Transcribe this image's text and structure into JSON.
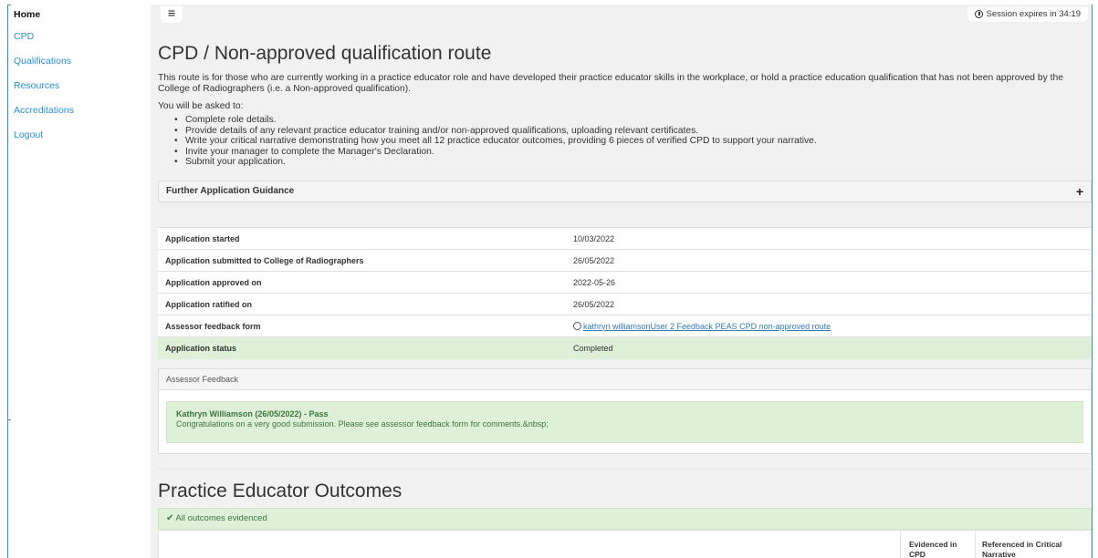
{
  "sidebar": {
    "items": [
      {
        "label": "Home"
      },
      {
        "label": "CPD"
      },
      {
        "label": "Qualifications"
      },
      {
        "label": "Resources"
      },
      {
        "label": "Accreditations"
      },
      {
        "label": "Logout"
      }
    ]
  },
  "header": {
    "menu_glyph": "≡",
    "session_text": "Session expires in 34:19"
  },
  "page": {
    "title": "CPD / Non-approved qualification route",
    "intro": "This route is for those who are currently working in a practice educator role and have developed their practice educator skills in the workplace, or hold a practice education qualification that has not been approved by the College of Radiographers (i.e. a Non-approved qualification).",
    "asked": "You will be asked to:",
    "steps": [
      "Complete role details.",
      "Provide details of any relevant practice educator training and/or non-approved qualifications, uploading relevant certificates.",
      "Write your critical narrative demonstrating how you meet all 12 practice educator outcomes, providing 6 pieces of verified CPD to support your narrative.",
      "Invite your manager to complete the Manager's Declaration.",
      "Submit your application."
    ],
    "guidance_label": "Further Application Guidance",
    "guidance_toggle": "+"
  },
  "application": {
    "rows": [
      {
        "label": "Application started",
        "value": "10/03/2022"
      },
      {
        "label": "Application submitted to College of Radiographers",
        "value": "26/05/2022"
      },
      {
        "label": "Application approved on",
        "value": "2022-05-26"
      },
      {
        "label": "Application ratified on",
        "value": "26/05/2022"
      },
      {
        "label": "Assessor feedback form",
        "value": "kathryn williamsonUser 2 Feedback PEAS CPD non-approved route"
      },
      {
        "label": "Application status",
        "value": "Completed"
      }
    ]
  },
  "feedback": {
    "heading": "Assessor Feedback",
    "title": "Kathryn Williamson (26/05/2022) - Pass",
    "text": "Congratulations on a very good submission. Please see assessor feedback form for comments.&nbsp;"
  },
  "outcomes": {
    "title": "Practice Educator Outcomes",
    "banner": "All outcomes evidenced",
    "col_cpd": "Evidenced in CPD",
    "col_narrative": "Referenced in Critical Narrative"
  },
  "colors": {
    "frame": "#3f9a8c",
    "link": "#2a8fd6",
    "success_bg": "#dff0d8",
    "success_text": "#3c763d"
  }
}
